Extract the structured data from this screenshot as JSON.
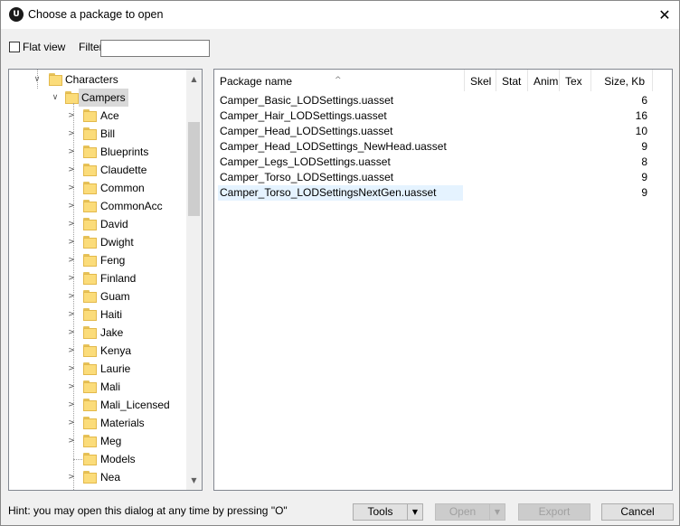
{
  "window": {
    "title": "Choose a package to open",
    "close_glyph": "✕",
    "app_icon_label": "U"
  },
  "toolbar": {
    "flat_view_label": "Flat view",
    "flat_view_checked": false,
    "filter_label": "Filter:",
    "filter_value": "",
    "filter_placeholder": ""
  },
  "tree": {
    "root": {
      "label": "Characters",
      "expanded": true
    },
    "selected": {
      "label": "Campers",
      "expanded": true
    },
    "children": [
      "Ace",
      "Bill",
      "Blueprints",
      "Claudette",
      "Common",
      "CommonAcc",
      "David",
      "Dwight",
      "Feng",
      "Finland",
      "Guam",
      "Haiti",
      "Jake",
      "Kenya",
      "Laurie",
      "Mali",
      "Mali_Licensed",
      "Materials",
      "Meg",
      "Models",
      "Nea"
    ],
    "leaf_children": [
      "Models"
    ]
  },
  "list": {
    "columns": {
      "name": "Package name",
      "skel": "Skel",
      "stat": "Stat",
      "anim": "Anim",
      "tex": "Tex",
      "size": "Size, Kb"
    },
    "rows": [
      {
        "name": "Camper_Basic_LODSettings.uasset",
        "size": "6"
      },
      {
        "name": "Camper_Hair_LODSettings.uasset",
        "size": "16"
      },
      {
        "name": "Camper_Head_LODSettings.uasset",
        "size": "10"
      },
      {
        "name": "Camper_Head_LODSettings_NewHead.uasset",
        "size": "9"
      },
      {
        "name": "Camper_Legs_LODSettings.uasset",
        "size": "8"
      },
      {
        "name": "Camper_Torso_LODSettings.uasset",
        "size": "9"
      },
      {
        "name": "Camper_Torso_LODSettingsNextGen.uasset",
        "size": "9"
      }
    ],
    "highlighted_row": 6
  },
  "footer": {
    "hint": "Hint: you may open this dialog at any time by pressing \"O\"",
    "tools_label": "Tools",
    "open_label": "Open",
    "export_label": "Export",
    "cancel_label": "Cancel",
    "dropdown_glyph": "▼"
  },
  "colors": {
    "selection": "#d9d9d9",
    "hover_row": "#e5f3ff",
    "folder": "#fbdc7a"
  }
}
